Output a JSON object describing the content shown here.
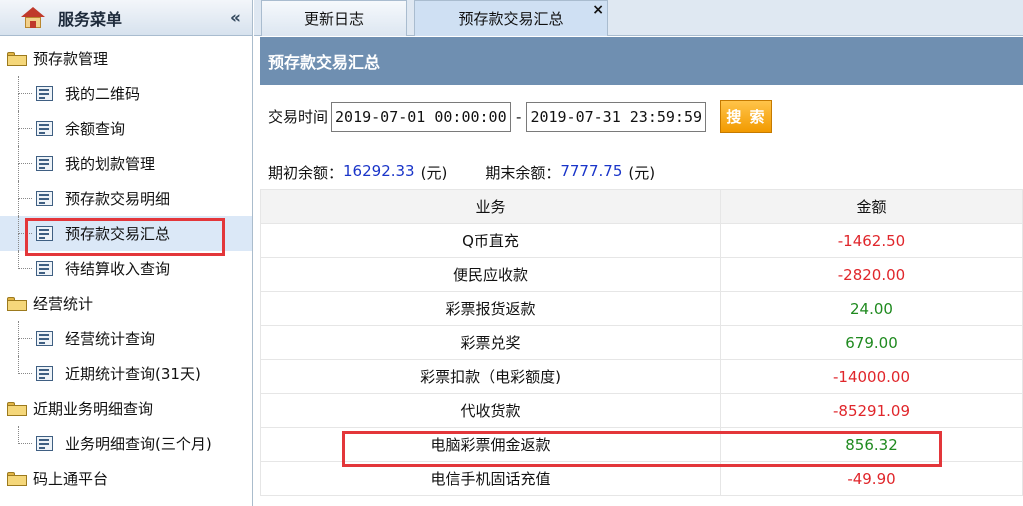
{
  "sidebar": {
    "title": "服务菜单",
    "collapse": "«",
    "groups": [
      {
        "label": "预存款管理",
        "items": [
          "我的二维码",
          "余额查询",
          "我的划款管理",
          "预存款交易明细",
          "预存款交易汇总",
          "待结算收入查询"
        ]
      },
      {
        "label": "经营统计",
        "items": [
          "经营统计查询",
          "近期统计查询(31天)"
        ]
      },
      {
        "label": "近期业务明细查询",
        "items": [
          "业务明细查询(三个月)"
        ]
      },
      {
        "label": "码上通平台",
        "items": []
      }
    ],
    "selected_item": "预存款交易汇总"
  },
  "tabs": [
    {
      "label": "更新日志"
    },
    {
      "label": "预存款交易汇总",
      "close": "×"
    }
  ],
  "panel": {
    "title": "预存款交易汇总"
  },
  "filter": {
    "label": "交易时间",
    "start": "2019-07-01 00:00:00",
    "separator": "-",
    "end": "2019-07-31 23:59:59",
    "search_label": "搜 索"
  },
  "balances": {
    "opening_label": "期初余额：",
    "opening_value": "16292.33",
    "opening_unit": "(元)",
    "closing_label": "期末余额：",
    "closing_value": "7777.75",
    "closing_unit": "(元)"
  },
  "table": {
    "headers": [
      "业务",
      "金额"
    ],
    "rows": [
      {
        "business": "Q币直充",
        "amount": "-1462.50"
      },
      {
        "business": "便民应收款",
        "amount": "-2820.00"
      },
      {
        "business": "彩票报货返款",
        "amount": "24.00"
      },
      {
        "business": "彩票兑奖",
        "amount": "679.00"
      },
      {
        "business": "彩票扣款（电彩额度)",
        "amount": "-14000.00"
      },
      {
        "business": "代收货款",
        "amount": "-85291.09"
      },
      {
        "business": "电脑彩票佣金返款",
        "amount": "856.32"
      },
      {
        "business": "电信手机固话充值",
        "amount": "-49.90"
      }
    ]
  },
  "colors": {
    "negative": "#e0262b",
    "positive": "#1f8a1f",
    "header_bar": "#6f8fb1",
    "highlight_box": "#e3363a"
  }
}
